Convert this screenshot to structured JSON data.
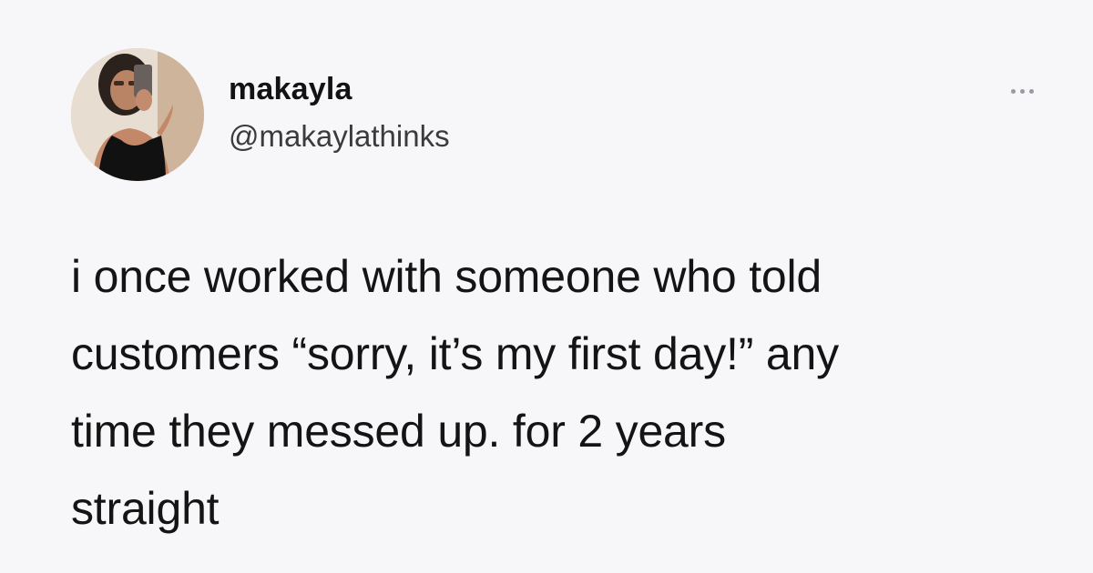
{
  "author": {
    "display_name": "makayla",
    "handle": "@makaylathinks",
    "avatar_icon": "profile-photo"
  },
  "menu": {
    "icon": "more-options-icon"
  },
  "tweet": {
    "lines": [
      "i once worked with someone who told",
      "customers “sorry, it’s my first day!” any",
      "time they messed up. for 2 years",
      "straight"
    ]
  },
  "colors": {
    "background": "#f7f7f9",
    "text": "#141414",
    "secondary_text": "#3b3b3b",
    "icon": "#9a9aa0"
  }
}
